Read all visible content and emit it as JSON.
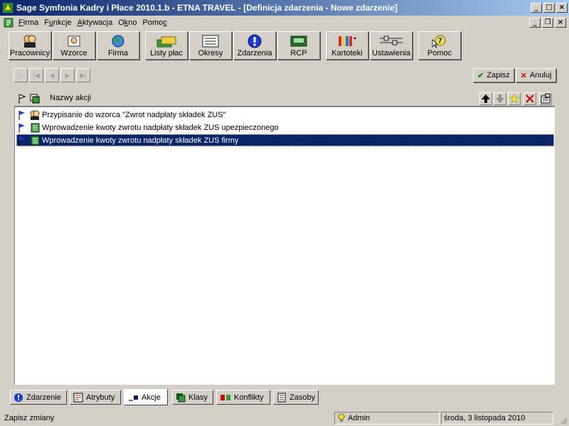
{
  "window": {
    "title": "Sage Symfonia Kadry i Płace 2010.1.b - ETNA TRAVEL - [Definicja zdarzenia - Nowe zdarzenie]"
  },
  "menu": [
    {
      "label": "Firma",
      "accel": "F",
      "rest": "irma"
    },
    {
      "label": "Funkcje",
      "accel": "u",
      "pre": "F",
      "rest": "nkcje"
    },
    {
      "label": "Aktywacja",
      "accel": "A",
      "rest": "ktywacja"
    },
    {
      "label": "Okno",
      "pre": "O",
      "accel": "k",
      "rest": "no"
    },
    {
      "label": "Pomoc",
      "pre": "Pomo",
      "accel": "c",
      "rest": ""
    }
  ],
  "toolbar": {
    "pracownicy": "Pracownicy",
    "wzorce": "Wzorce",
    "firma": "Firma",
    "listy_plac": "Listy płac",
    "okresy": "Okresy",
    "zdarzenia": "Zdarzenia",
    "rcp": "RCP",
    "kartoteki": "Kartoteki",
    "ustawienia": "Ustawienia",
    "pomoc": "Pomoc"
  },
  "actions": {
    "zapisz": "Zapisz",
    "anuluj": "Anuluj"
  },
  "list": {
    "column_header": "Nazwy akcji",
    "rows": [
      {
        "text": "Przypisanie do wzorca \"Zwrot nadpłaty składek ZUS\"",
        "type": "wzorzec"
      },
      {
        "text": "Wprowadzenie kwoty zwrotu nadpłaty składek ZUS upezpieczonego",
        "type": "kwota"
      },
      {
        "text": "Wprowadzenie kwoty zwrotu nadpłaty składek ZUS firmy",
        "type": "kwota",
        "selected": true
      }
    ]
  },
  "tabs": [
    {
      "label": "Zdarzenie"
    },
    {
      "label": "Atrybuty"
    },
    {
      "label": "Akcje",
      "active": true
    },
    {
      "label": "Klasy"
    },
    {
      "label": "Konflikty"
    },
    {
      "label": "Zasoby"
    }
  ],
  "status": {
    "message": "Zapisz zmiany",
    "user": "Admin",
    "date": "środa, 3 listopada 2010"
  },
  "colors": {
    "title_bar": "#0a246a",
    "selection": "#0a246a",
    "window_bg": "#d4d0c8"
  }
}
